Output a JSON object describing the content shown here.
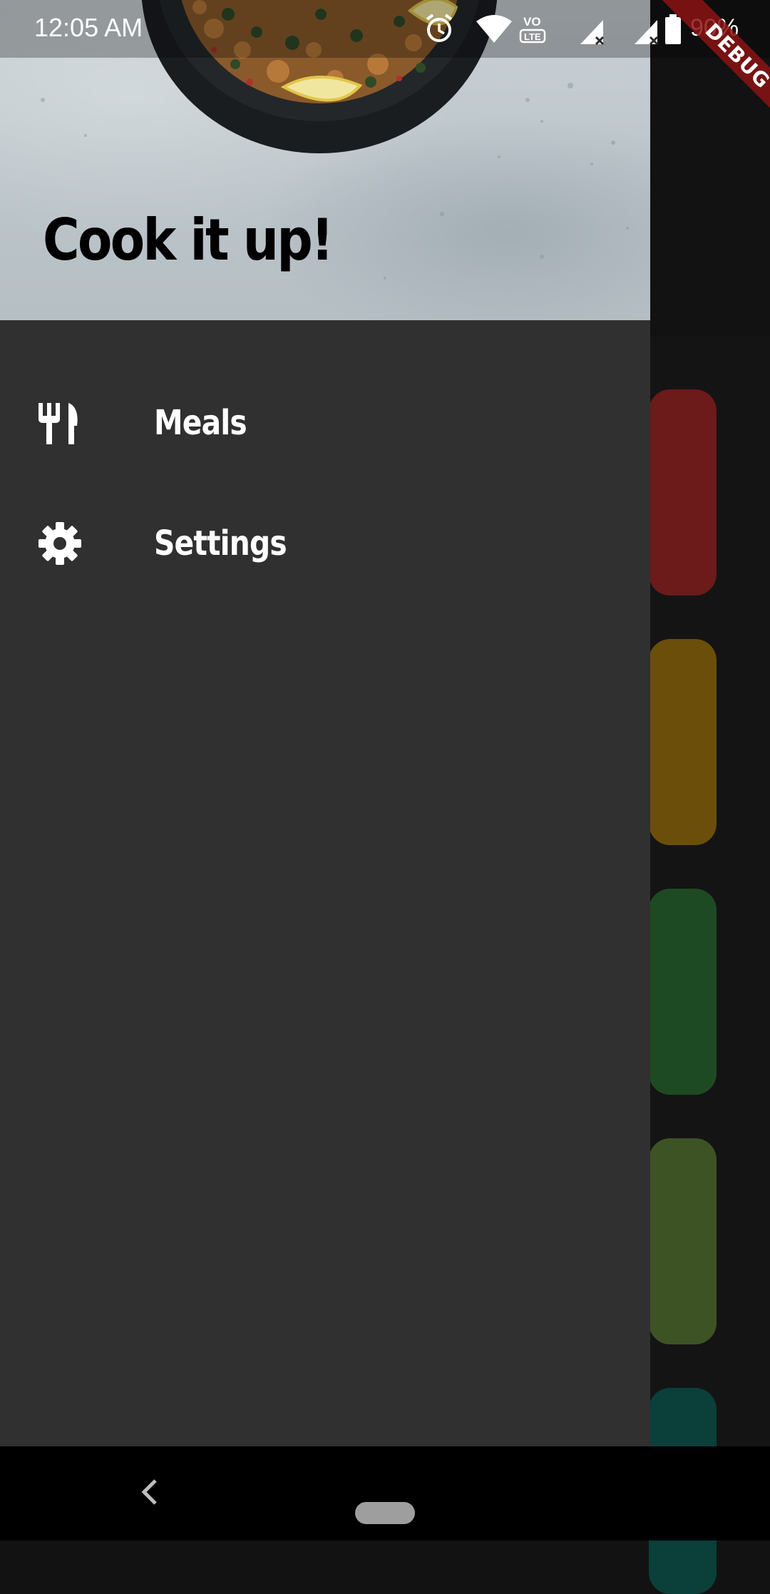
{
  "status_bar": {
    "time": "12:05 AM",
    "battery": "90%",
    "icons": [
      "alarm-icon",
      "wifi-icon",
      "volte-icon",
      "signal-icon",
      "signal-icon",
      "battery-icon"
    ]
  },
  "debug_banner": {
    "label": "DEBUG"
  },
  "drawer": {
    "header_title": "Cook it up!",
    "items": [
      {
        "label": "Meals",
        "icon": "restaurant-icon"
      },
      {
        "label": "Settings",
        "icon": "settings-icon"
      }
    ]
  },
  "background_categories": {
    "tile_colors": [
      "#6c1a1a",
      "#6b4e0a",
      "#1e4a23",
      "#3d5324",
      "#0a3f3a"
    ]
  },
  "nav_bar": {
    "icons": [
      "back-icon",
      "home-pill"
    ]
  }
}
